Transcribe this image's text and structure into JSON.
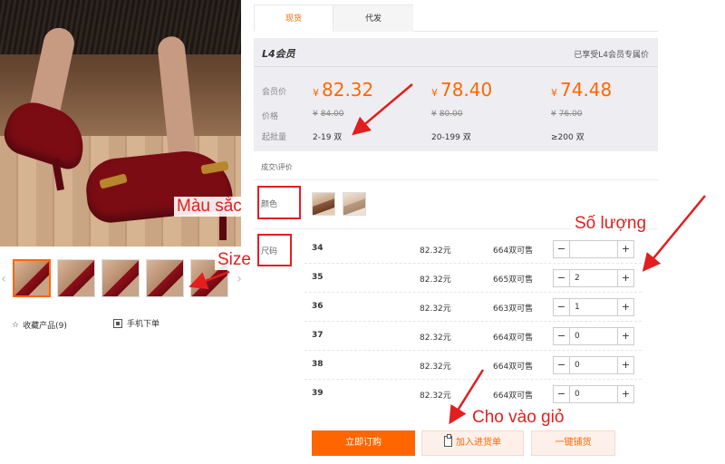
{
  "gallery": {
    "thumbnail_count": 5,
    "collect_label": "收藏产品(9)",
    "mobile_order_label": "手机下单",
    "icons": [
      "star-icon",
      "qr-code-icon",
      "chevron-left-icon",
      "chevron-right-icon"
    ]
  },
  "tabs": [
    {
      "label": "现货",
      "active": true
    },
    {
      "label": "代发",
      "active": false
    }
  ],
  "price_panel": {
    "level": "L4会员",
    "enjoy_text": "已享受L4会员专属价",
    "member_price_label": "会员价",
    "price_label": "价格",
    "batch_label": "起批量",
    "currency": "¥",
    "tiers": [
      {
        "member_price": "82.32",
        "original_price": "84.00",
        "batch": "2-19 双"
      },
      {
        "member_price": "78.40",
        "original_price": "80.00",
        "batch": "20-199 双"
      },
      {
        "member_price": "74.48",
        "original_price": "76.00",
        "batch": "≥200 双"
      }
    ]
  },
  "deal_label": "成交\\评价",
  "color_label": "颜色",
  "size_label": "尺码",
  "sizes": [
    {
      "size": "34",
      "price": "82.32元",
      "stock": "664双可售",
      "qty": ""
    },
    {
      "size": "35",
      "price": "82.32元",
      "stock": "665双可售",
      "qty": "2"
    },
    {
      "size": "36",
      "price": "82.32元",
      "stock": "663双可售",
      "qty": "1"
    },
    {
      "size": "37",
      "price": "82.32元",
      "stock": "664双可售",
      "qty": "0"
    },
    {
      "size": "38",
      "price": "82.32元",
      "stock": "664双可售",
      "qty": "0"
    },
    {
      "size": "39",
      "price": "82.32元",
      "stock": "664双可售",
      "qty": "0"
    }
  ],
  "stepper": {
    "minus": "−",
    "plus": "+"
  },
  "actions": {
    "order": "立即订购",
    "cart": "加入进货单",
    "distribute": "一键铺货"
  },
  "annotations": {
    "color": "Màu sắc",
    "size": "Size",
    "quantity": "Số lượng",
    "cart": "Cho vào giỏ"
  },
  "colors": {
    "accent": "#ff6600",
    "annotation": "#e31e1e"
  }
}
